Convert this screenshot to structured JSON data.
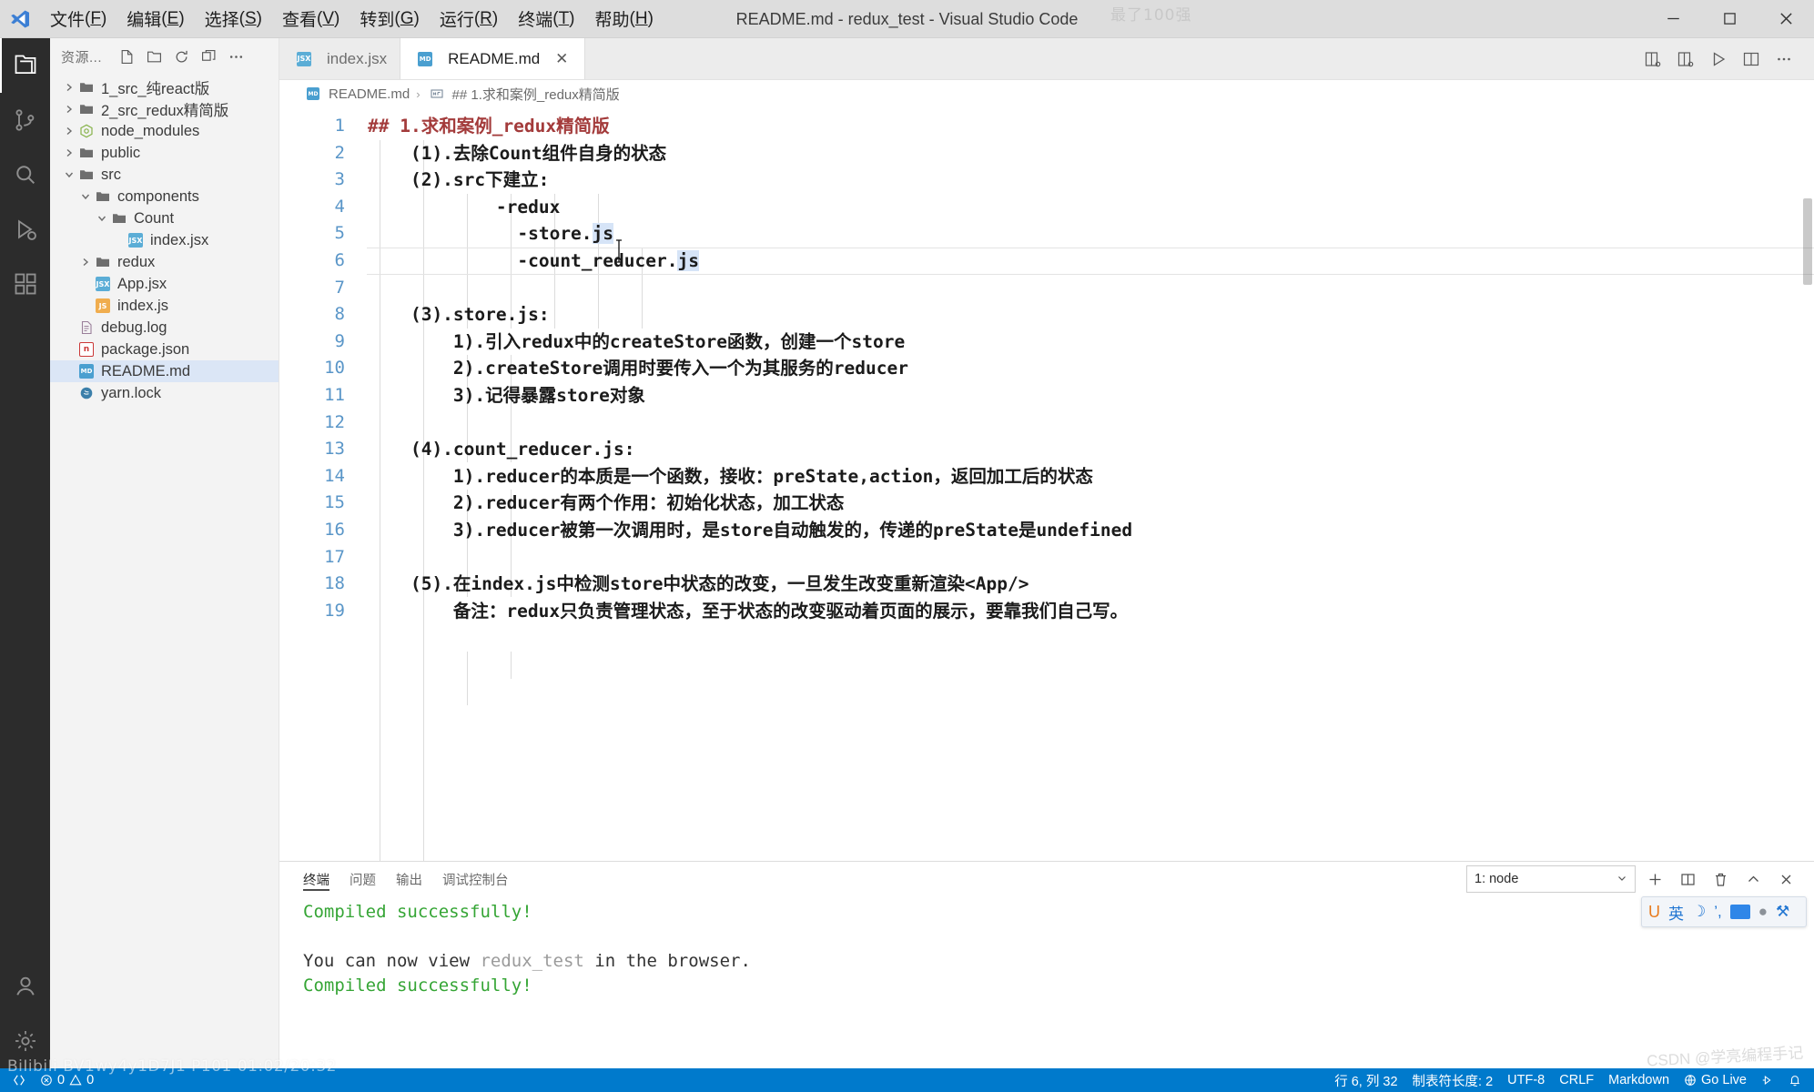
{
  "window": {
    "title": "README.md - redux_test - Visual Studio Code",
    "watermark_top": "最了100强",
    "minimize": "—",
    "maximize": "❐",
    "close": "✕"
  },
  "menubar": [
    {
      "label": "文件",
      "accel": "F"
    },
    {
      "label": "编辑",
      "accel": "E"
    },
    {
      "label": "选择",
      "accel": "S"
    },
    {
      "label": "查看",
      "accel": "V"
    },
    {
      "label": "转到",
      "accel": "G"
    },
    {
      "label": "运行",
      "accel": "R"
    },
    {
      "label": "终端",
      "accel": "T"
    },
    {
      "label": "帮助",
      "accel": "H"
    }
  ],
  "activitybar": [
    {
      "name": "explorer",
      "icon": "files-icon",
      "active": true
    },
    {
      "name": "source-control",
      "icon": "source-control-icon",
      "active": false
    },
    {
      "name": "search",
      "icon": "search-icon",
      "active": false
    },
    {
      "name": "run-debug",
      "icon": "run-debug-icon",
      "active": false
    },
    {
      "name": "extensions",
      "icon": "extensions-icon",
      "active": false
    },
    {
      "name": "accounts",
      "icon": "account-icon",
      "active": false
    },
    {
      "name": "settings",
      "icon": "gear-icon",
      "active": false
    }
  ],
  "sidebar": {
    "title": "资源...",
    "actions": [
      "new-file-icon",
      "new-folder-icon",
      "refresh-icon",
      "collapse-all-icon",
      "more-actions-icon"
    ],
    "tree": [
      {
        "label": "1_src_纯react版",
        "type": "folder",
        "indent": 0,
        "expanded": false,
        "selected": false
      },
      {
        "label": "2_src_redux精简版",
        "type": "folder",
        "indent": 0,
        "expanded": false,
        "selected": false
      },
      {
        "label": "node_modules",
        "type": "node-modules",
        "indent": 0,
        "expanded": false,
        "selected": false
      },
      {
        "label": "public",
        "type": "folder",
        "indent": 0,
        "expanded": false,
        "selected": false
      },
      {
        "label": "src",
        "type": "folder",
        "indent": 0,
        "expanded": true,
        "selected": false
      },
      {
        "label": "components",
        "type": "folder",
        "indent": 1,
        "expanded": true,
        "selected": false
      },
      {
        "label": "Count",
        "type": "folder",
        "indent": 2,
        "expanded": true,
        "selected": false
      },
      {
        "label": "index.jsx",
        "type": "jsx",
        "indent": 3,
        "expanded": null,
        "selected": false
      },
      {
        "label": "redux",
        "type": "folder",
        "indent": 1,
        "expanded": false,
        "selected": false
      },
      {
        "label": "App.jsx",
        "type": "jsx",
        "indent": 2,
        "expanded": null,
        "selected": false
      },
      {
        "label": "index.js",
        "type": "js",
        "indent": 2,
        "expanded": null,
        "selected": false
      },
      {
        "label": "debug.log",
        "type": "log",
        "indent": 1,
        "expanded": null,
        "selected": false
      },
      {
        "label": "package.json",
        "type": "json",
        "indent": 1,
        "expanded": null,
        "selected": false
      },
      {
        "label": "README.md",
        "type": "md",
        "indent": 1,
        "expanded": null,
        "selected": true
      },
      {
        "label": "yarn.lock",
        "type": "lock",
        "indent": 1,
        "expanded": null,
        "selected": false
      }
    ]
  },
  "editor": {
    "tabs": [
      {
        "label": "index.jsx",
        "type": "jsx",
        "active": false,
        "closable": false
      },
      {
        "label": "README.md",
        "type": "md",
        "active": true,
        "closable": true,
        "close": "✕"
      }
    ],
    "tab_actions": [
      "split-editor-right-icon",
      "open-changes-icon",
      "run-markdown-preview-icon",
      "split-editor-icon",
      "more-actions-icon"
    ],
    "breadcrumb": [
      {
        "label": "README.md",
        "icon": "md-icon"
      },
      {
        "label": "## 1.求和案例_redux精简版",
        "icon": "symbol-string-icon"
      }
    ],
    "breadcrumb_separator": "›",
    "lines": [
      {
        "n": 1,
        "text": "## 1.求和案例_redux精简版",
        "heading": true,
        "indent": 0
      },
      {
        "n": 2,
        "text": "    (1).去除Count组件自身的状态",
        "heading": false,
        "indent": 0
      },
      {
        "n": 3,
        "text": "    (2).src下建立:",
        "heading": false,
        "indent": 0
      },
      {
        "n": 4,
        "text": "            -redux",
        "heading": false,
        "indent": 0
      },
      {
        "n": 5,
        "text": "              -store.js",
        "heading": false,
        "indent": 0,
        "hl": "js"
      },
      {
        "n": 6,
        "text": "              -count_reducer.js",
        "heading": false,
        "indent": 0,
        "hl": "js",
        "current": true
      },
      {
        "n": 7,
        "text": "",
        "heading": false,
        "indent": 0
      },
      {
        "n": 8,
        "text": "    (3).store.js:",
        "heading": false,
        "indent": 0
      },
      {
        "n": 9,
        "text": "        1).引入redux中的createStore函数，创建一个store",
        "heading": false,
        "indent": 0
      },
      {
        "n": 10,
        "text": "        2).createStore调用时要传入一个为其服务的reducer",
        "heading": false,
        "indent": 0
      },
      {
        "n": 11,
        "text": "        3).记得暴露store对象",
        "heading": false,
        "indent": 0
      },
      {
        "n": 12,
        "text": "",
        "heading": false,
        "indent": 0
      },
      {
        "n": 13,
        "text": "    (4).count_reducer.js:",
        "heading": false,
        "indent": 0
      },
      {
        "n": 14,
        "text": "        1).reducer的本质是一个函数，接收：preState,action，返回加工后的状态",
        "heading": false,
        "indent": 0
      },
      {
        "n": 15,
        "text": "        2).reducer有两个作用：初始化状态，加工状态",
        "heading": false,
        "indent": 0
      },
      {
        "n": 16,
        "text": "        3).reducer被第一次调用时，是store自动触发的，传递的preState是undefined",
        "heading": false,
        "indent": 0
      },
      {
        "n": 17,
        "text": "",
        "heading": false,
        "indent": 0
      },
      {
        "n": 18,
        "text": "    (5).在index.js中检测store中状态的改变，一旦发生改变重新渲染<App/>",
        "heading": false,
        "indent": 0
      },
      {
        "n": 19,
        "text": "        备注：redux只负责管理状态，至于状态的改变驱动着页面的展示，要靠我们自己写。",
        "heading": false,
        "indent": 0
      }
    ]
  },
  "panel": {
    "tabs": [
      {
        "label": "终端",
        "active": true
      },
      {
        "label": "问题",
        "active": false
      },
      {
        "label": "输出",
        "active": false
      },
      {
        "label": "调试控制台",
        "active": false
      }
    ],
    "terminal_select": "1: node",
    "select_arrow": "⌄",
    "actions": [
      "add-terminal-icon",
      "split-terminal-icon",
      "kill-terminal-icon",
      "collapse-panel-icon",
      "close-panel-icon"
    ],
    "output": [
      {
        "text": "Compiled successfully!",
        "color": "green"
      },
      {
        "text": "",
        "color": "plain"
      },
      {
        "text": "",
        "color": "plain"
      },
      {
        "segments": [
          {
            "text": "You can now view ",
            "color": "plain"
          },
          {
            "text": "redux_test",
            "color": "dim"
          },
          {
            "text": " in the browser.",
            "color": "plain"
          }
        ]
      },
      {
        "text": "Compiled successfully!",
        "color": "green"
      }
    ],
    "ime": {
      "logo": "U",
      "mode": "英",
      "moon": "☽",
      "punct": "’,",
      "keyboard": "keyboard-icon",
      "person": "●",
      "tools": "⚒"
    }
  },
  "statusbar": {
    "left": [
      {
        "name": "remote-indicator",
        "label": ""
      },
      {
        "name": "problems",
        "label": "0",
        "label2": "0"
      }
    ],
    "errors": "0",
    "warnings": "0",
    "right": [
      {
        "name": "cursor-position",
        "label": "行 6, 列 32"
      },
      {
        "name": "indentation",
        "label": "制表符长度: 2"
      },
      {
        "name": "encoding",
        "label": "UTF-8"
      },
      {
        "name": "eol",
        "label": "CRLF"
      },
      {
        "name": "language-mode",
        "label": "Markdown"
      },
      {
        "name": "go-live",
        "label": "Go Live"
      },
      {
        "name": "feedback",
        "label": ""
      },
      {
        "name": "notifications",
        "label": ""
      }
    ]
  },
  "watermarks": {
    "bilibili": "BiIibiIi BV1wy4y1D7J1 P101 01:02/20:32",
    "csdn": "CSDN @学亮编程手记"
  },
  "colors": {
    "accent": "#007acc",
    "titlebar": "#dddddd",
    "activitybar": "#2c2c2c",
    "sidebar": "#f3f3f3",
    "editor_bg": "#ffffff",
    "heading": "#a33b3b",
    "linenumber": "#5a96c8",
    "terminal_green": "#35a535",
    "selection_highlight": "#d6e4f7"
  }
}
